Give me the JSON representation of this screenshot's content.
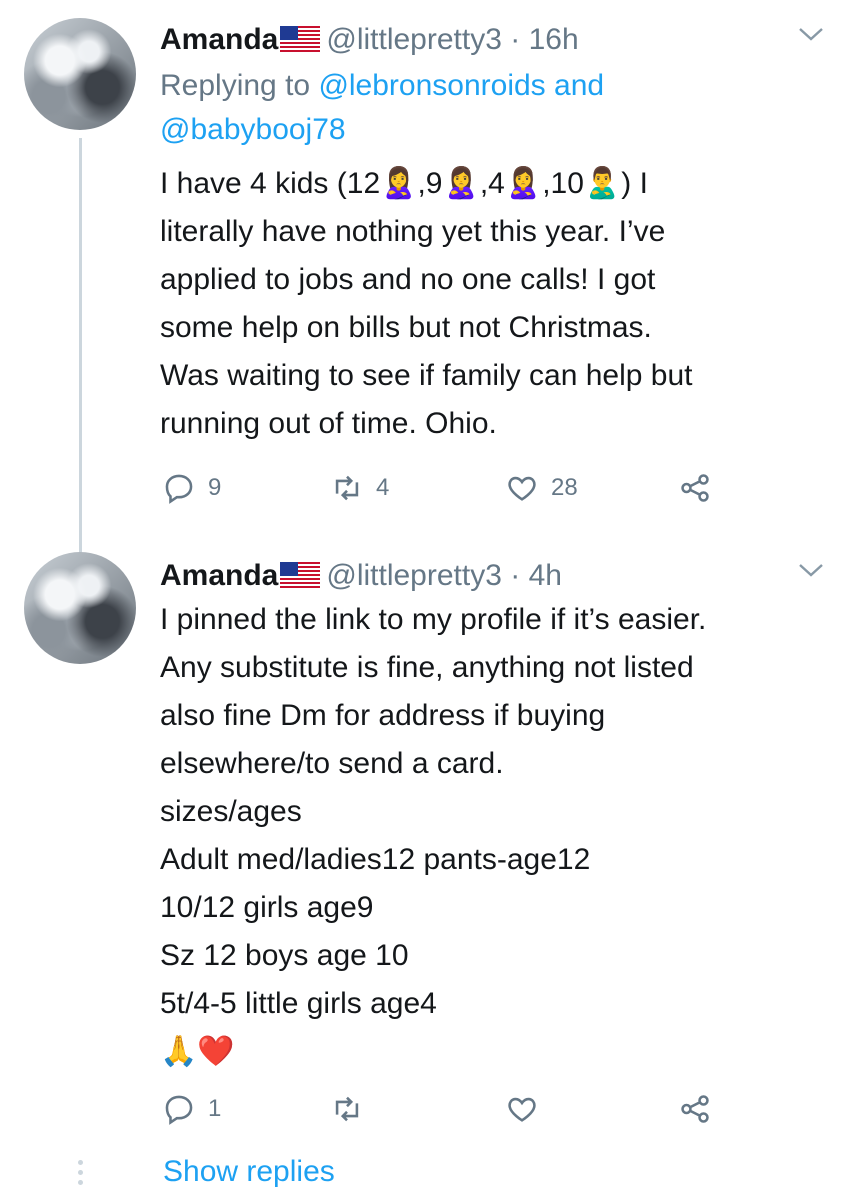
{
  "tweets": [
    {
      "name": "Amanda",
      "handle": "@littlepretty3",
      "separator": "·",
      "time": "16h",
      "reply_prefix": "Replying to",
      "reply_user1": "@lebronsonroids",
      "reply_and": "and",
      "reply_user2": "@babybooj78",
      "lines": [
        "I have 4 kids (12🙎‍♀️,9🙎‍♀️,4🙎‍♀️,10🙎‍♂️) I",
        "literally have nothing yet this year. I’ve",
        "applied to jobs and no one calls! I got",
        "some help on bills but not Christmas.",
        "Was waiting to see if family can help but",
        "running out of time. Ohio."
      ],
      "replies": "9",
      "retweets": "4",
      "likes": "28"
    },
    {
      "name": "Amanda",
      "handle": "@littlepretty3",
      "separator": "·",
      "time": "4h",
      "lines": [
        "I pinned the link to my profile if it’s easier.",
        "Any substitute is fine, anything not listed",
        "also fine Dm for address if buying",
        "elsewhere/to send a card.",
        "sizes/ages",
        "Adult med/ladies12 pants-age12",
        "10/12 girls age9",
        "Sz 12 boys age 10",
        "5t/4-5 little girls age4",
        "🙏❤️"
      ],
      "replies": "1"
    }
  ],
  "show_replies": "Show replies",
  "icons": [
    "flag-us-icon",
    "chevron-down-icon",
    "reply-icon",
    "retweet-icon",
    "like-icon",
    "share-icon"
  ],
  "colors": {
    "link": "#1da1f2",
    "muted": "#657786",
    "text": "#14171a",
    "thread": "#ccd6dd"
  }
}
